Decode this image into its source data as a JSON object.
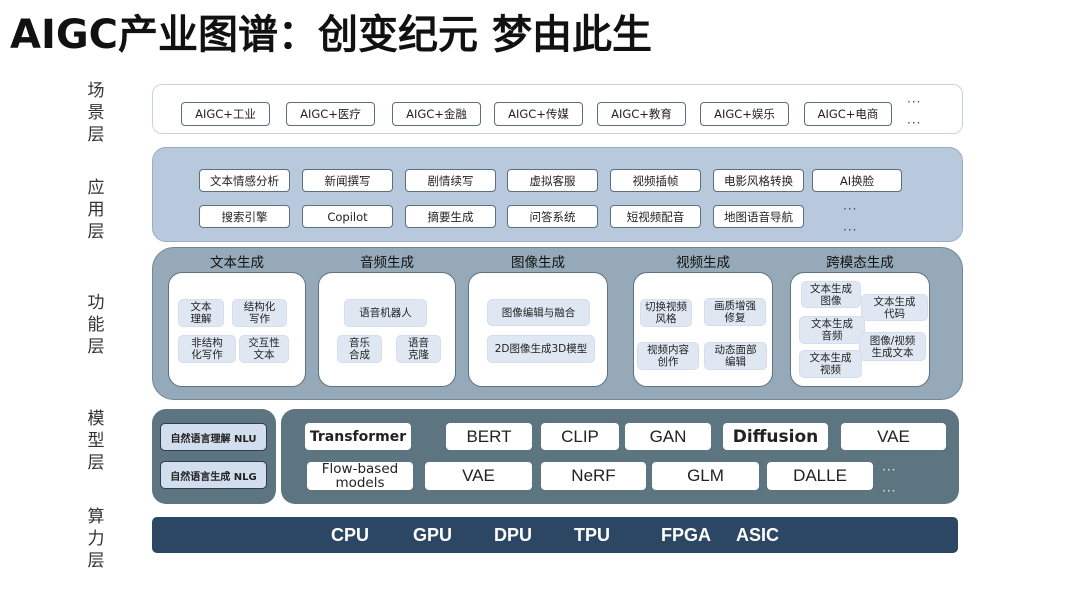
{
  "title": "AIGC产业图谱：创变纪元  梦由此生",
  "layers": {
    "scene": {
      "label": [
        "场",
        "景",
        "层"
      ],
      "items": [
        "AIGC+工业",
        "AIGC+医疗",
        "AIGC+金融",
        "AIGC+传媒",
        "AIGC+教育",
        "AIGC+娱乐",
        "AIGC+电商"
      ],
      "more": "···"
    },
    "application": {
      "label": [
        "应",
        "用",
        "层"
      ],
      "row1": [
        "文本情感分析",
        "新闻撰写",
        "剧情续写",
        "虚拟客服",
        "视频插帧",
        "电影风格转换",
        "AI换脸"
      ],
      "row2": [
        "搜索引擎",
        "Copilot",
        "摘要生成",
        "问答系统",
        "短视频配音",
        "地图语音导航"
      ],
      "more": "···"
    },
    "function": {
      "label": [
        "功",
        "能",
        "层"
      ],
      "groups": [
        {
          "title": "文本生成",
          "items": [
            "文本\n理解",
            "结构化\n写作",
            "非结构\n化写作",
            "交互性\n文本"
          ]
        },
        {
          "title": "音频生成",
          "items": [
            "语音机器人",
            "音乐\n合成",
            "语音\n克隆"
          ]
        },
        {
          "title": "图像生成",
          "items": [
            "图像编辑与融合",
            "2D图像生成3D模型"
          ]
        },
        {
          "title": "视频生成",
          "items": [
            "切换视频\n风格",
            "画质增强\n修复",
            "视频内容\n创作",
            "动态面部\n编辑"
          ]
        },
        {
          "title": "跨模态生成",
          "items": [
            "文本生成\n图像",
            "文本生成\n代码",
            "文本生成\n音频",
            "图像/视频\n生成文本",
            "文本生成\n视频"
          ]
        }
      ]
    },
    "model": {
      "label": [
        "模",
        "型",
        "层"
      ],
      "nl": [
        "自然语言理解 NLU",
        "自然语言生成 NLG"
      ],
      "row1": [
        "Transformer",
        "BERT",
        "CLIP",
        "GAN",
        "Diffusion",
        "VAE"
      ],
      "row2": [
        "Flow-based\nmodels",
        "VAE",
        "NeRF",
        "GLM",
        "DALLE"
      ],
      "more": "···"
    },
    "compute": {
      "label": [
        "算",
        "力",
        "层"
      ],
      "items": [
        "CPU",
        "GPU",
        "DPU",
        "TPU",
        "FPGA",
        "ASIC"
      ]
    }
  },
  "colors": {
    "scene_border": "#c9d3df",
    "application_bg": "#b8c9de",
    "function_bg": "#95a9b8",
    "function_chip": "#dfe7f2",
    "model_bg": "#5d7581",
    "nl_chip": "#d2dded",
    "compute_bg": "#2c4763"
  }
}
